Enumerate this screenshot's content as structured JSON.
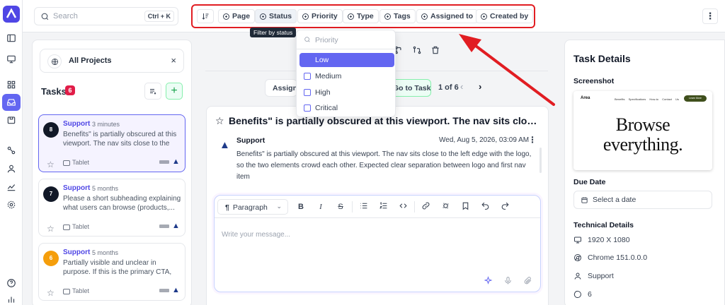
{
  "search": {
    "placeholder": "Search",
    "shortcut": "Ctrl + K"
  },
  "filters": {
    "chips": [
      {
        "label": "Page"
      },
      {
        "label": "Status"
      },
      {
        "label": "Priority"
      },
      {
        "label": "Type"
      },
      {
        "label": "Tags"
      },
      {
        "label": "Assigned to"
      },
      {
        "label": "Created by"
      }
    ],
    "tooltip": "Filter by status"
  },
  "dropdown": {
    "search_placeholder": "Priority",
    "options": [
      {
        "label": "Low",
        "selected": true
      },
      {
        "label": "Medium",
        "selected": false
      },
      {
        "label": "High",
        "selected": false
      },
      {
        "label": "Critical",
        "selected": false
      }
    ]
  },
  "tasks_panel": {
    "project": "All Projects",
    "title": "Tasks",
    "count": "6",
    "cards": [
      {
        "avatar": "8",
        "avatar_color": "#111827",
        "project": "Support",
        "time": "3 minutes",
        "desc": "Benefits\" is partially obscured at this viewport. The nav sits close to the le...",
        "device": "Tablet",
        "active": true
      },
      {
        "avatar": "7",
        "avatar_color": "#111827",
        "project": "Support",
        "time": "5 months",
        "desc": "Please a short subheading explaining what users can browse (products,...",
        "device": "Tablet",
        "active": false
      },
      {
        "avatar": "6",
        "avatar_color": "#f59e0b",
        "project": "Support",
        "time": "5 months",
        "desc": "Partially visible and unclear in purpose. If this is the primary CTA, it...",
        "device": "Tablet",
        "active": false
      }
    ]
  },
  "middle": {
    "assign_label": "Assign",
    "go_task_label": "Go to Task",
    "pager": "1 of 6",
    "thread": {
      "title": "Benefits\" is partially obscured at this viewport. The nav sits close to the left edge with the logo",
      "author": "Support",
      "date": "Wed, Aug 5, 2026, 03:09 AM",
      "body": "Benefits\" is partially obscured at this viewport. The nav sits close to the left edge with the logo, so the two elements crowd each other. Expected clear separation between logo and first nav item"
    },
    "editor": {
      "paragraph_label": "Paragraph",
      "placeholder": "Write your message..."
    }
  },
  "details": {
    "title": "Task Details",
    "screenshot_label": "Screenshot",
    "screenshot": {
      "logo": "Area",
      "nav": "Benefits Specifications How-to Contact Us",
      "button": "Learn More",
      "headline_1": "Browse",
      "headline_2": "everything."
    },
    "due_date_label": "Due Date",
    "due_date_placeholder": "Select a date",
    "technical_label": "Technical Details",
    "resolution": "1920 X 1080",
    "browser": "Chrome 151.0.0.0",
    "reporter": "Support",
    "os_version": "6"
  },
  "colors": {
    "accent": "#6366f1",
    "annotation": "#e11d22",
    "badge": "#e11d48"
  }
}
